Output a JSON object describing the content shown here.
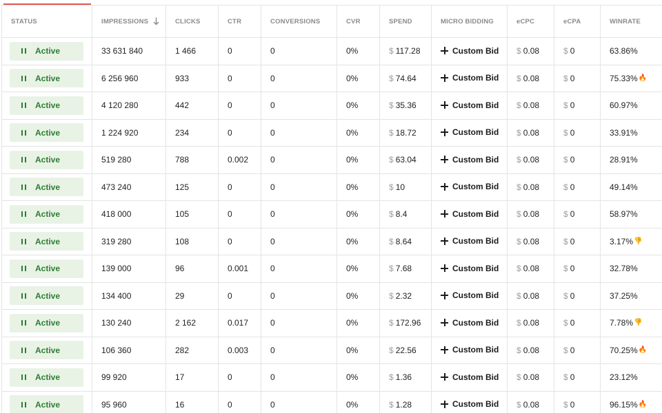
{
  "header": {
    "status": "STATUS",
    "impressions": "IMPRESSIONS",
    "clicks": "CLICKS",
    "ctr": "CTR",
    "conversions": "CONVERSIONS",
    "cvr": "CVR",
    "spend": "SPEND",
    "micro_bidding": "MICRO BIDDING",
    "ecpc": "eCPC",
    "ecpa": "eCPA",
    "winrate": "WINRATE"
  },
  "currency_symbol": "$",
  "colors": {
    "accent": "#e05a4f",
    "status_bg": "#e8f3e6",
    "status_text": "#2e7d32"
  },
  "rows": [
    {
      "status": "Active",
      "impressions": "33 631 840",
      "clicks": "1 466",
      "ctr": "0",
      "conversions": "0",
      "cvr": "0%",
      "spend": "117.28",
      "bid": "Custom Bid",
      "ecpc": "0.08",
      "ecpa": "0",
      "winrate": "63.86%",
      "winrate_icon": ""
    },
    {
      "status": "Active",
      "impressions": "6 256 960",
      "clicks": "933",
      "ctr": "0",
      "conversions": "0",
      "cvr": "0%",
      "spend": "74.64",
      "bid": "Custom Bid",
      "ecpc": "0.08",
      "ecpa": "0",
      "winrate": "75.33%",
      "winrate_icon": "🔥"
    },
    {
      "status": "Active",
      "impressions": "4 120 280",
      "clicks": "442",
      "ctr": "0",
      "conversions": "0",
      "cvr": "0%",
      "spend": "35.36",
      "bid": "Custom Bid",
      "ecpc": "0.08",
      "ecpa": "0",
      "winrate": "60.97%",
      "winrate_icon": ""
    },
    {
      "status": "Active",
      "impressions": "1 224 920",
      "clicks": "234",
      "ctr": "0",
      "conversions": "0",
      "cvr": "0%",
      "spend": "18.72",
      "bid": "Custom Bid",
      "ecpc": "0.08",
      "ecpa": "0",
      "winrate": "33.91%",
      "winrate_icon": ""
    },
    {
      "status": "Active",
      "impressions": "519 280",
      "clicks": "788",
      "ctr": "0.002",
      "conversions": "0",
      "cvr": "0%",
      "spend": "63.04",
      "bid": "Custom Bid",
      "ecpc": "0.08",
      "ecpa": "0",
      "winrate": "28.91%",
      "winrate_icon": ""
    },
    {
      "status": "Active",
      "impressions": "473 240",
      "clicks": "125",
      "ctr": "0",
      "conversions": "0",
      "cvr": "0%",
      "spend": "10",
      "bid": "Custom Bid",
      "ecpc": "0.08",
      "ecpa": "0",
      "winrate": "49.14%",
      "winrate_icon": ""
    },
    {
      "status": "Active",
      "impressions": "418 000",
      "clicks": "105",
      "ctr": "0",
      "conversions": "0",
      "cvr": "0%",
      "spend": "8.4",
      "bid": "Custom Bid",
      "ecpc": "0.08",
      "ecpa": "0",
      "winrate": "58.97%",
      "winrate_icon": ""
    },
    {
      "status": "Active",
      "impressions": "319 280",
      "clicks": "108",
      "ctr": "0",
      "conversions": "0",
      "cvr": "0%",
      "spend": "8.64",
      "bid": "Custom Bid",
      "ecpc": "0.08",
      "ecpa": "0",
      "winrate": "3.17%",
      "winrate_icon": "👎"
    },
    {
      "status": "Active",
      "impressions": "139 000",
      "clicks": "96",
      "ctr": "0.001",
      "conversions": "0",
      "cvr": "0%",
      "spend": "7.68",
      "bid": "Custom Bid",
      "ecpc": "0.08",
      "ecpa": "0",
      "winrate": "32.78%",
      "winrate_icon": ""
    },
    {
      "status": "Active",
      "impressions": "134 400",
      "clicks": "29",
      "ctr": "0",
      "conversions": "0",
      "cvr": "0%",
      "spend": "2.32",
      "bid": "Custom Bid",
      "ecpc": "0.08",
      "ecpa": "0",
      "winrate": "37.25%",
      "winrate_icon": ""
    },
    {
      "status": "Active",
      "impressions": "130 240",
      "clicks": "2 162",
      "ctr": "0.017",
      "conversions": "0",
      "cvr": "0%",
      "spend": "172.96",
      "bid": "Custom Bid",
      "ecpc": "0.08",
      "ecpa": "0",
      "winrate": "7.78%",
      "winrate_icon": "👎"
    },
    {
      "status": "Active",
      "impressions": "106 360",
      "clicks": "282",
      "ctr": "0.003",
      "conversions": "0",
      "cvr": "0%",
      "spend": "22.56",
      "bid": "Custom Bid",
      "ecpc": "0.08",
      "ecpa": "0",
      "winrate": "70.25%",
      "winrate_icon": "🔥"
    },
    {
      "status": "Active",
      "impressions": "99 920",
      "clicks": "17",
      "ctr": "0",
      "conversions": "0",
      "cvr": "0%",
      "spend": "1.36",
      "bid": "Custom Bid",
      "ecpc": "0.08",
      "ecpa": "0",
      "winrate": "23.12%",
      "winrate_icon": ""
    },
    {
      "status": "Active",
      "impressions": "95 960",
      "clicks": "16",
      "ctr": "0",
      "conversions": "0",
      "cvr": "0%",
      "spend": "1.28",
      "bid": "Custom Bid",
      "ecpc": "0.08",
      "ecpa": "0",
      "winrate": "96.15%",
      "winrate_icon": "🔥"
    }
  ]
}
